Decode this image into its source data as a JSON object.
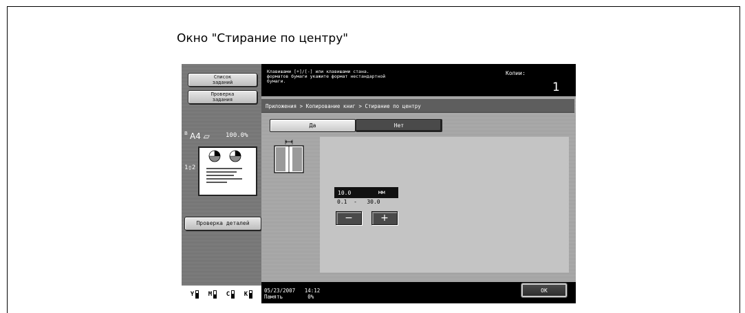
{
  "caption": "Окно \"Стирание по центру\"",
  "sidebar": {
    "job_list_line1": "Список",
    "job_list_line2": "заданий",
    "job_check_line1": "Проверка",
    "job_check_line2": "задания",
    "paper_flag": "B",
    "paper_size": "A4",
    "paper_icon": "▱",
    "zoom": "100.0%",
    "copy_mode": "1▯2",
    "detail_button": "Проверка деталей",
    "toner": [
      {
        "label": "Y",
        "level": 0.7
      },
      {
        "label": "M",
        "level": 0.55
      },
      {
        "label": "C",
        "level": 0.6
      },
      {
        "label": "K",
        "level": 0.75
      }
    ]
  },
  "message_bar": {
    "text": "Клавишами [+]/[-] или клавишами стана.\nформатов бумаги укажите формат нестандартной\nбумаги.",
    "copies_label": "Копии:",
    "copies_count": "1"
  },
  "breadcrumb": "Приложения > Копирование книг > Стирание по центру",
  "toggles": {
    "yes": "Да",
    "no": "Нет",
    "selected": "no"
  },
  "value": {
    "current": "10.0",
    "unit": "мм",
    "range": "0.1  -   30.0",
    "minus": "−",
    "plus": "+"
  },
  "footer": {
    "date_time": "05/23/2007   14:12",
    "memory_label": "Память        0%",
    "ok": "OK"
  }
}
